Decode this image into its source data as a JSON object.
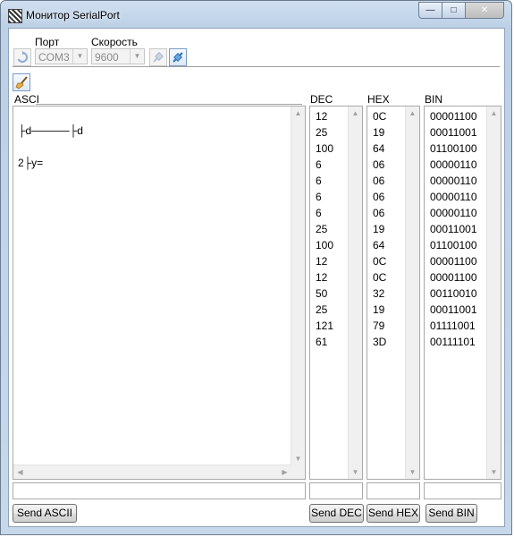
{
  "window": {
    "title": "Монитор SerialPort",
    "min_glyph": "—",
    "max_glyph": "□",
    "close_glyph": "✕"
  },
  "port": {
    "label": "Порт",
    "value": "COM3"
  },
  "speed": {
    "label": "Скорость",
    "value": "9600"
  },
  "icons": {
    "refresh": "refresh-icon",
    "disconnect": "disconnect-plug-icon",
    "connect": "connect-plug-icon",
    "clear": "broom-icon"
  },
  "panels": {
    "ascii_title": "ASCI",
    "dec_title": "DEC",
    "hex_title": "HEX",
    "bin_title": "BIN"
  },
  "ascii_lines": [
    "├d─────├d",
    "2├y="
  ],
  "rows": [
    {
      "dec": "12",
      "hex": "0C",
      "bin": "00001100"
    },
    {
      "dec": "25",
      "hex": "19",
      "bin": "00011001"
    },
    {
      "dec": "100",
      "hex": "64",
      "bin": "01100100"
    },
    {
      "dec": "6",
      "hex": "06",
      "bin": "00000110"
    },
    {
      "dec": "6",
      "hex": "06",
      "bin": "00000110"
    },
    {
      "dec": "6",
      "hex": "06",
      "bin": "00000110"
    },
    {
      "dec": "6",
      "hex": "06",
      "bin": "00000110"
    },
    {
      "dec": "25",
      "hex": "19",
      "bin": "00011001"
    },
    {
      "dec": "100",
      "hex": "64",
      "bin": "01100100"
    },
    {
      "dec": "12",
      "hex": "0C",
      "bin": "00001100"
    },
    {
      "dec": "12",
      "hex": "0C",
      "bin": "00001100"
    },
    {
      "dec": "50",
      "hex": "32",
      "bin": "00110010"
    },
    {
      "dec": "25",
      "hex": "19",
      "bin": "00011001"
    },
    {
      "dec": "121",
      "hex": "79",
      "bin": "01111001"
    },
    {
      "dec": "61",
      "hex": "3D",
      "bin": "00111101"
    }
  ],
  "buttons": {
    "send_ascii": "Send ASCII",
    "send_dec": "Send DEC",
    "send_hex": "Send HEX",
    "send_bin": "Send BIN"
  },
  "scroll_glyphs": {
    "up": "▲",
    "down": "▼",
    "left": "◀",
    "right": "▶"
  }
}
